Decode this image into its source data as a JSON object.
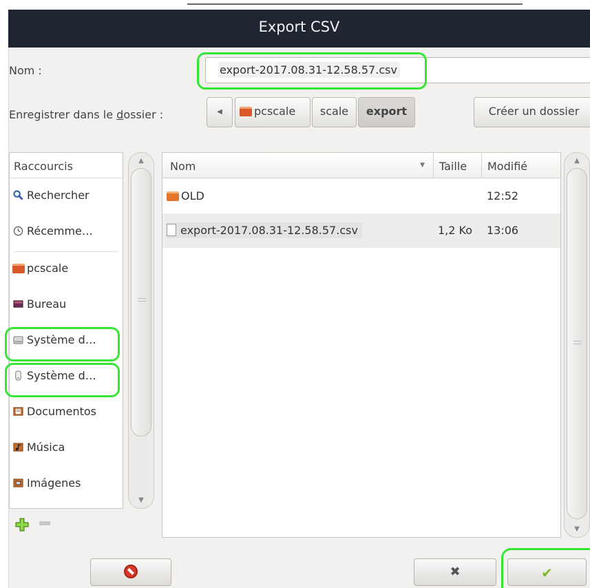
{
  "window": {
    "title": "Export CSV"
  },
  "form": {
    "name_label": "Nom :",
    "name_value": "export-2017.08.31-12.58.57.csv",
    "folder_label_before": "Enregistrer dans le ",
    "folder_label_mnemonic": "d",
    "folder_label_after": "ossier :",
    "breadcrumbs": [
      "pcscale",
      "scale",
      "export"
    ],
    "create_folder": "Créer un dossier"
  },
  "sidebar": {
    "header": "Raccourcis",
    "items": [
      {
        "label": "Rechercher",
        "icon": "magnifier-icon"
      },
      {
        "label": "Récemme…",
        "icon": "recent-clock-icon"
      },
      {
        "label": "pcscale",
        "icon": "home-folder-icon"
      },
      {
        "label": "Bureau",
        "icon": "desktop-icon"
      },
      {
        "label": "Système d…",
        "icon": "hard-drive-icon"
      },
      {
        "label": "Système d…",
        "icon": "usb-drive-icon"
      },
      {
        "label": "Documentos",
        "icon": "documents-folder-icon"
      },
      {
        "label": "Música",
        "icon": "music-folder-icon"
      },
      {
        "label": "Imágenes",
        "icon": "pictures-folder-icon"
      }
    ]
  },
  "files": {
    "columns": [
      "Nom",
      "Taille",
      "Modifié"
    ],
    "rows": [
      {
        "name": "OLD",
        "size": "",
        "modified": "12:52",
        "type": "folder"
      },
      {
        "name": "export-2017.08.31-12.58.57.csv",
        "size": "1,2 Ko",
        "modified": "13:06",
        "type": "file"
      }
    ]
  },
  "colors": {
    "highlight": "#35e635",
    "titlebar": "#1f2631",
    "dialog_bg": "#f2f1f0"
  }
}
